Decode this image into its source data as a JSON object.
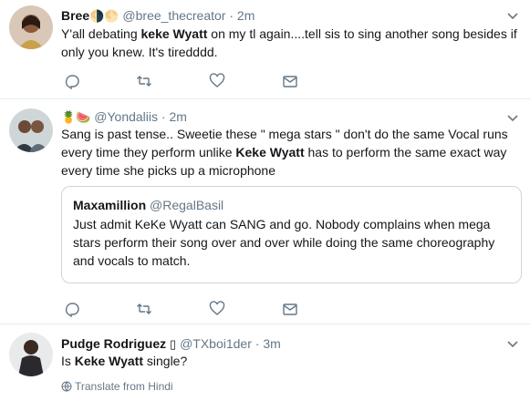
{
  "tweets": [
    {
      "name": "Bree",
      "name_emoji": "🌗🌕",
      "handle": "@bree_thecreator",
      "separator": "·",
      "time": "2m",
      "text_parts": [
        "Y'all debating ",
        "keke Wyatt",
        " on my tl again....tell sis to sing another song besides if only you knew. It's tiredddd."
      ]
    },
    {
      "name_emoji": "🍍🍉",
      "handle": "@Yondaliis",
      "separator": "·",
      "time": "2m",
      "text_parts": [
        "Sang is past tense.. Sweetie these \" mega stars \" don't do the same Vocal runs every time they perform unlike ",
        "Keke Wyatt",
        " has to perform the same exact way every time she picks up a microphone"
      ],
      "quote": {
        "name": "Maxamillion",
        "handle": "@RegalBasil",
        "text": "Just admit KeKe Wyatt can SANG and go. Nobody complains when mega stars perform their song over and over while doing the same choreography and vocals to match."
      }
    },
    {
      "name": "Pudge Rodriguez",
      "name_emoji": "▯",
      "handle": "@TXboi1der",
      "separator": "·",
      "time": "3m",
      "text_parts": [
        "Is ",
        "Keke Wyatt",
        " single?"
      ],
      "translate": "Translate from Hindi"
    }
  ],
  "icons": {
    "reply": "reply-icon",
    "retweet": "retweet-icon",
    "like": "heart-icon",
    "dm": "envelope-icon",
    "caret": "chevron-down-icon",
    "globe": "globe-icon"
  },
  "colors": {
    "text": "#14171a",
    "secondary": "#657786",
    "border": "#e6ecf0",
    "quote_border": "#ccd6dd"
  }
}
